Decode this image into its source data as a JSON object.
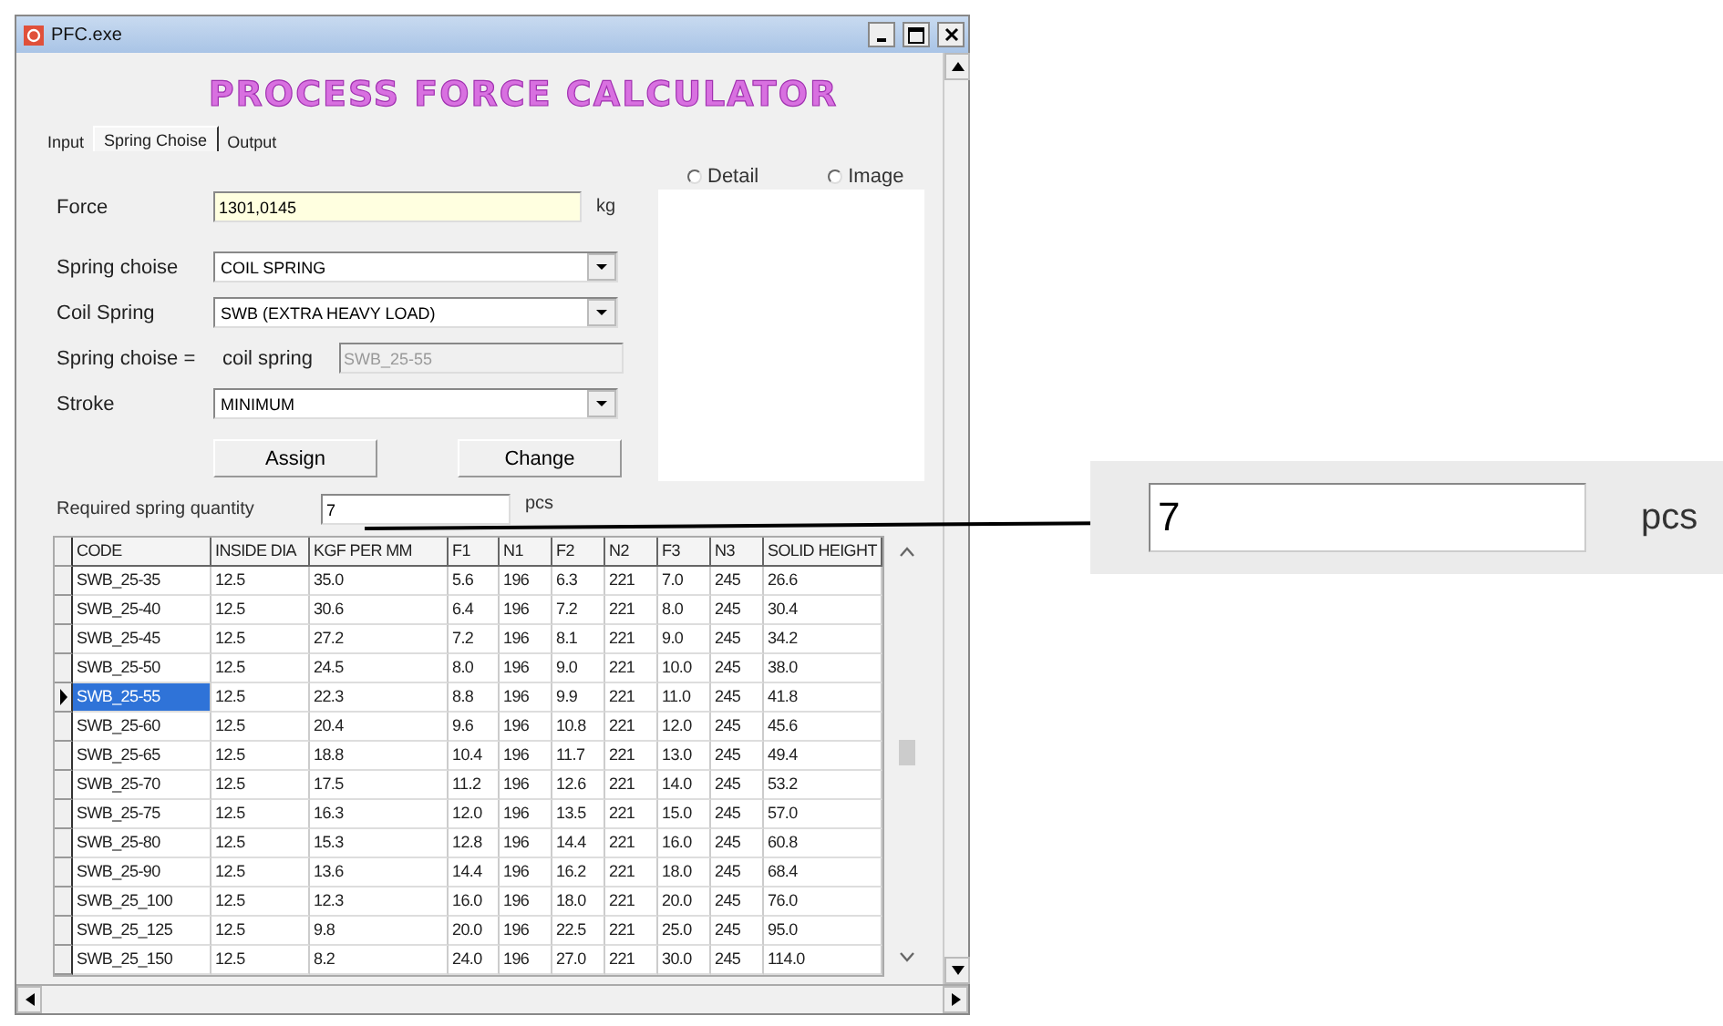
{
  "window": {
    "title": "PFC.exe"
  },
  "heading": "PROCESS FORCE CALCULATOR",
  "tabs": [
    {
      "label": "Input",
      "selected": false
    },
    {
      "label": "Spring Choise",
      "selected": true
    },
    {
      "label": "Output",
      "selected": false
    }
  ],
  "view_options": [
    {
      "label": "Detail",
      "selected": false
    },
    {
      "label": "Image",
      "selected": false
    }
  ],
  "form": {
    "force": {
      "label": "Force",
      "value": "1301,0145",
      "unit": "kg"
    },
    "spring_choise": {
      "label": "Spring choise",
      "value": "COIL SPRING"
    },
    "coil_spring": {
      "label": "Coil Spring",
      "value": "SWB (EXTRA HEAVY LOAD)"
    },
    "spring_result": {
      "label": "Spring choise =",
      "sublabel": "coil spring",
      "value": "SWB_25-55"
    },
    "stroke": {
      "label": "Stroke",
      "value": "MINIMUM"
    },
    "buttons": [
      "Assign",
      "Change"
    ],
    "quantity": {
      "label": "Required spring quantity",
      "value": "7",
      "unit": "pcs"
    }
  },
  "table": {
    "columns": [
      "CODE",
      "INSIDE DIA",
      "KGF PER MM",
      "F1",
      "N1",
      "F2",
      "N2",
      "F3",
      "N3",
      "SOLID HEIGHT"
    ],
    "rows": [
      {
        "selected": false,
        "cells": [
          "SWB_25-35",
          "12.5",
          "35.0",
          "5.6",
          "196",
          "6.3",
          "221",
          "7.0",
          "245",
          "26.6"
        ]
      },
      {
        "selected": false,
        "cells": [
          "SWB_25-40",
          "12.5",
          "30.6",
          "6.4",
          "196",
          "7.2",
          "221",
          "8.0",
          "245",
          "30.4"
        ]
      },
      {
        "selected": false,
        "cells": [
          "SWB_25-45",
          "12.5",
          "27.2",
          "7.2",
          "196",
          "8.1",
          "221",
          "9.0",
          "245",
          "34.2"
        ]
      },
      {
        "selected": false,
        "cells": [
          "SWB_25-50",
          "12.5",
          "24.5",
          "8.0",
          "196",
          "9.0",
          "221",
          "10.0",
          "245",
          "38.0"
        ]
      },
      {
        "selected": true,
        "cells": [
          "SWB_25-55",
          "12.5",
          "22.3",
          "8.8",
          "196",
          "9.9",
          "221",
          "11.0",
          "245",
          "41.8"
        ]
      },
      {
        "selected": false,
        "cells": [
          "SWB_25-60",
          "12.5",
          "20.4",
          "9.6",
          "196",
          "10.8",
          "221",
          "12.0",
          "245",
          "45.6"
        ]
      },
      {
        "selected": false,
        "cells": [
          "SWB_25-65",
          "12.5",
          "18.8",
          "10.4",
          "196",
          "11.7",
          "221",
          "13.0",
          "245",
          "49.4"
        ]
      },
      {
        "selected": false,
        "cells": [
          "SWB_25-70",
          "12.5",
          "17.5",
          "11.2",
          "196",
          "12.6",
          "221",
          "14.0",
          "245",
          "53.2"
        ]
      },
      {
        "selected": false,
        "cells": [
          "SWB_25-75",
          "12.5",
          "16.3",
          "12.0",
          "196",
          "13.5",
          "221",
          "15.0",
          "245",
          "57.0"
        ]
      },
      {
        "selected": false,
        "cells": [
          "SWB_25-80",
          "12.5",
          "15.3",
          "12.8",
          "196",
          "14.4",
          "221",
          "16.0",
          "245",
          "60.8"
        ]
      },
      {
        "selected": false,
        "cells": [
          "SWB_25-90",
          "12.5",
          "13.6",
          "14.4",
          "196",
          "16.2",
          "221",
          "18.0",
          "245",
          "68.4"
        ]
      },
      {
        "selected": false,
        "cells": [
          "SWB_25_100",
          "12.5",
          "12.3",
          "16.0",
          "196",
          "18.0",
          "221",
          "20.0",
          "245",
          "76.0"
        ]
      },
      {
        "selected": false,
        "cells": [
          "SWB_25_125",
          "12.5",
          "9.8",
          "20.0",
          "196",
          "22.5",
          "221",
          "25.0",
          "245",
          "95.0"
        ]
      },
      {
        "selected": false,
        "cells": [
          "SWB_25_150",
          "12.5",
          "8.2",
          "24.0",
          "196",
          "27.0",
          "221",
          "30.0",
          "245",
          "114.0"
        ]
      }
    ]
  },
  "callout": {
    "value": "7",
    "unit": "pcs"
  }
}
